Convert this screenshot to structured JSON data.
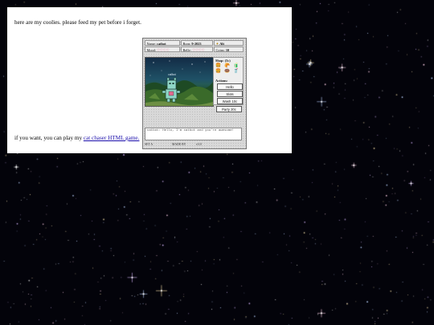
{
  "page": {
    "intro_text": "here are my coolies. please feed my pet before i forget.",
    "outro_prefix": "if you want, you can play my ",
    "outro_link": "cat chaser HTML game."
  },
  "pet": {
    "name_label": "Name:",
    "name": "catbot",
    "born_label": "Born:",
    "born": "9-2023",
    "status": "Alt",
    "mood_label": "Mood:",
    "mood_hearts": "♡♡♡♡",
    "belly_label": "Belly:",
    "belly_hearts": "♡♡♡♡",
    "coins_label": "Coins:",
    "coins": "10",
    "scene_name": "catbot",
    "shop_title": "Shop: (5c)",
    "foods": [
      "🍔",
      "🥐",
      "🧃",
      "🍔",
      "🍩",
      "🥤"
    ],
    "actions_title": "Actions:",
    "actions": [
      "Hello",
      "Slots",
      "Wash 10c",
      "Party 20c"
    ],
    "chat": "catbot: Hello, I'm catbot and you're awesome!",
    "footer_left": "SET A",
    "footer_mid": "MADE BY",
    "footer_right": "v3.0"
  },
  "colors": {
    "background": "#03030a",
    "panel": "#ffffff",
    "link": "#1a0dab",
    "heart": "#e0457b"
  }
}
